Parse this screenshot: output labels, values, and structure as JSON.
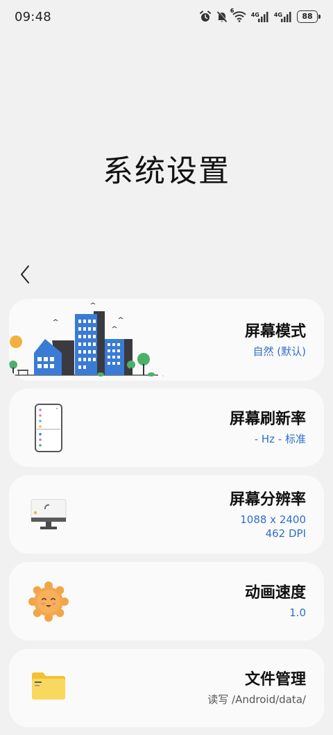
{
  "status_bar": {
    "time": "09:48",
    "cell1": "4G",
    "cell2": "4G",
    "wifi_label": "6",
    "battery": "88",
    "icons": [
      "alarm-icon",
      "mute-icon",
      "wifi-icon",
      "signal-icon",
      "signal-icon",
      "battery-icon"
    ]
  },
  "page": {
    "title": "系统设置"
  },
  "cards": [
    {
      "title": "屏幕模式",
      "subtitle": "自然 (默认)",
      "icon": "city-illustration-icon"
    },
    {
      "title": "屏幕刷新率",
      "subtitle": "- Hz - 标准",
      "icon": "phone-icon"
    },
    {
      "title": "屏幕分辨率",
      "subtitle_line1": "1088 x 2400",
      "subtitle_line2": "462 DPI",
      "icon": "monitor-icon"
    },
    {
      "title": "动画速度",
      "subtitle": "1.0",
      "icon": "sun-face-icon"
    },
    {
      "title": "文件管理",
      "subtitle": "读写 /Android/data/",
      "icon": "folder-icon"
    }
  ],
  "colors": {
    "accent": "#2f6fc9",
    "background": "#f1f1f1",
    "card": "#fafafa"
  }
}
